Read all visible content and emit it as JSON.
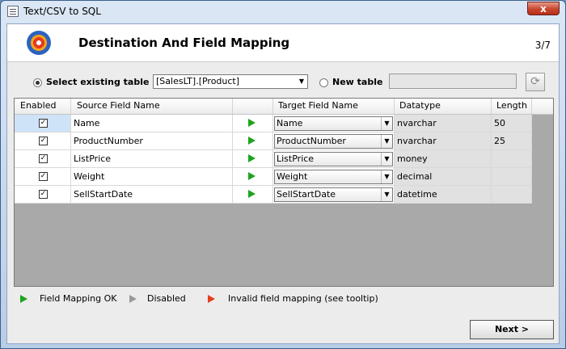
{
  "window": {
    "title": "Text/CSV to SQL",
    "close_glyph": "x"
  },
  "header": {
    "title": "Destination And Field Mapping",
    "step": "3/7"
  },
  "destination": {
    "existing_label": "Select existing table",
    "existing_selected": true,
    "table_value": "[SalesLT].[Product]",
    "new_label": "New table",
    "new_table_value": ""
  },
  "grid": {
    "headers": {
      "enabled": "Enabled",
      "source": "Source Field Name",
      "target": "Target Field Name",
      "datatype": "Datatype",
      "length": "Length"
    },
    "rows": [
      {
        "enabled": true,
        "source": "Name",
        "target": "Name",
        "datatype": "nvarchar",
        "length": "50",
        "status": "ok"
      },
      {
        "enabled": true,
        "source": "ProductNumber",
        "target": "ProductNumber",
        "datatype": "nvarchar",
        "length": "25",
        "status": "ok"
      },
      {
        "enabled": true,
        "source": "ListPrice",
        "target": "ListPrice",
        "datatype": "money",
        "length": "",
        "status": "ok"
      },
      {
        "enabled": true,
        "source": "Weight",
        "target": "Weight",
        "datatype": "decimal",
        "length": "",
        "status": "ok"
      },
      {
        "enabled": true,
        "source": "SellStartDate",
        "target": "SellStartDate",
        "datatype": "datetime",
        "length": "",
        "status": "ok"
      }
    ]
  },
  "legend": {
    "ok": "Field Mapping OK",
    "disabled": "Disabled",
    "invalid": "Invalid field mapping (see tooltip)"
  },
  "buttons": {
    "next": "Next >"
  },
  "colors": {
    "ok": "#1fa31f",
    "disabled": "#9a9a9a",
    "invalid": "#e0401c"
  }
}
